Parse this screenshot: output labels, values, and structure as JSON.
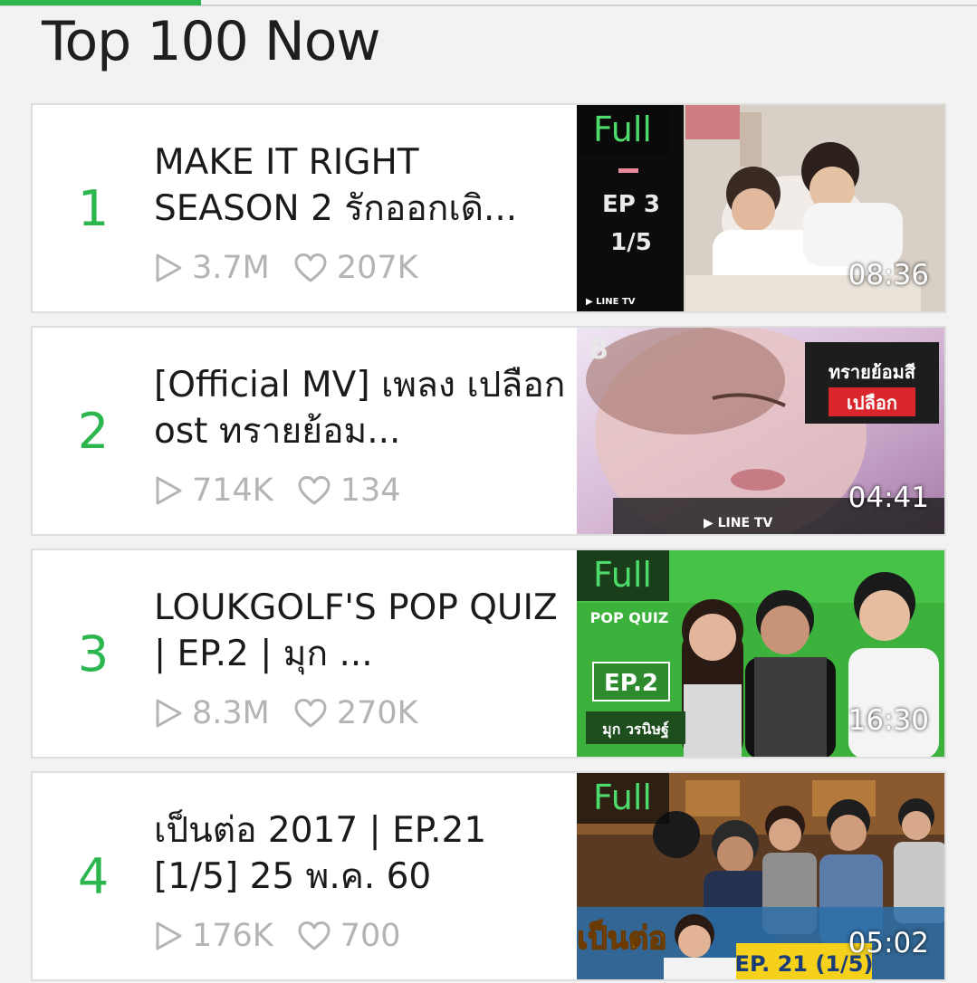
{
  "section_title": "Top 100 Now",
  "colors": {
    "accent": "#2cb64e",
    "badge_text": "#4ddc6c",
    "stat_gray": "#b4b4b4"
  },
  "icons": {
    "views": "play-outline-icon",
    "likes": "heart-outline-icon"
  },
  "items": [
    {
      "rank": "1",
      "title": "MAKE IT RIGHT SEASON 2 รักออกเดิ...",
      "views": "3.7M",
      "likes": "207K",
      "badge": "Full",
      "duration": "08:36",
      "thumb_text": [
        "EP 3",
        "1/5",
        "LINE TV"
      ]
    },
    {
      "rank": "2",
      "title": "[Official MV] เพลง เปลือก ost ทรายย้อม...",
      "views": "714K",
      "likes": "134",
      "badge": "",
      "duration": "04:41",
      "thumb_text": [
        "8",
        "ทรายย้อมสี",
        "เปลือก",
        "LINE TV"
      ]
    },
    {
      "rank": "3",
      "title": "LOUKGOLF'S POP QUIZ  | EP.2 | มุก ...",
      "views": "8.3M",
      "likes": "270K",
      "badge": "Full",
      "duration": "16:30",
      "thumb_text": [
        "POP QUIZ",
        "EP.2",
        "มุก วรนิษฐ์"
      ]
    },
    {
      "rank": "4",
      "title": "เป็นต่อ 2017 | EP.21 [1/5] 25 พ.ค. 60",
      "views": "176K",
      "likes": "700",
      "badge": "Full",
      "duration": "05:02",
      "thumb_text": [
        "เป็นต่อ",
        "EP. 21 (1/5)"
      ]
    }
  ]
}
